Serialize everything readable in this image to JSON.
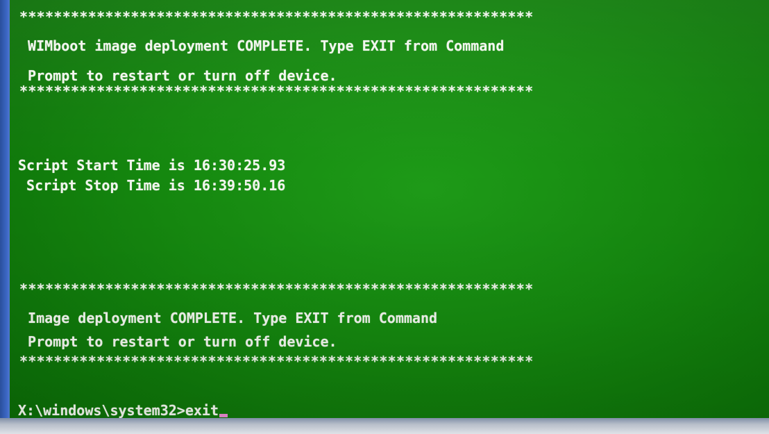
{
  "console": {
    "banner1": {
      "top_border": "************************************************************",
      "line1": " WIMboot image deployment COMPLETE. Type EXIT from Command",
      "line2": " Prompt to restart or turn off device.",
      "bottom_border": "************************************************************"
    },
    "timing": {
      "start": "Script Start Time is 16:30:25.93",
      "stop": " Script Stop Time is 16:39:50.16"
    },
    "banner2": {
      "top_border": "************************************************************",
      "line1": " Image deployment COMPLETE. Type EXIT from Command",
      "line2": " Prompt to restart or turn off device.",
      "bottom_border": "************************************************************"
    },
    "prompt": {
      "path": "X:\\windows\\system32>",
      "input": "exit"
    }
  },
  "colors": {
    "background": "#15880f",
    "text": "#f2f6ee",
    "cursor": "#e98ad0"
  }
}
